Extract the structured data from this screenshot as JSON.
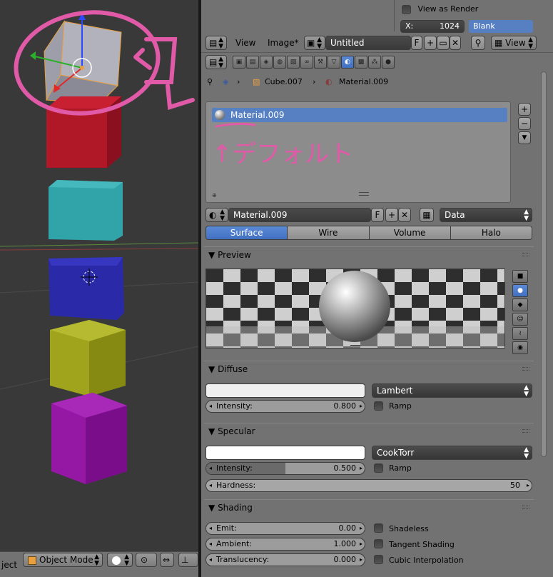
{
  "top": {
    "view_as_render": "View as Render",
    "x_label": "X:",
    "x_value": "1024",
    "blank_label": "Blank"
  },
  "image_header": {
    "view_menu": "View",
    "image_menu": "Image*",
    "image_name": "Untitled",
    "fake_user": "F",
    "view_dropdown": "View"
  },
  "breadcrumb": {
    "object": "Cube.007",
    "material": "Material.009"
  },
  "material_slots": {
    "selected": "Material.009"
  },
  "material_field": {
    "name": "Material.009",
    "fake_user": "F",
    "link": "Data"
  },
  "render_tabs": [
    "Surface",
    "Wire",
    "Volume",
    "Halo"
  ],
  "preview": {
    "title": "Preview"
  },
  "diffuse": {
    "title": "Diffuse",
    "color": "#f0f0f0",
    "shader": "Lambert",
    "intensity_label": "Intensity:",
    "intensity": "0.800",
    "intensity_value": 0.8,
    "ramp_label": "Ramp"
  },
  "specular": {
    "title": "Specular",
    "color": "#ffffff",
    "shader": "CookTorr",
    "intensity_label": "Intensity:",
    "intensity": "0.500",
    "intensity_value": 0.5,
    "ramp_label": "Ramp",
    "hardness_label": "Hardness:",
    "hardness": "50"
  },
  "shading": {
    "title": "Shading",
    "emit_label": "Emit:",
    "emit": "0.00",
    "ambient_label": "Ambient:",
    "ambient": "1.000",
    "translucency_label": "Translucency:",
    "translucency": "0.000",
    "shadeless_label": "Shadeless",
    "tangent_label": "Tangent Shading",
    "cubic_label": "Cubic Interpolation"
  },
  "viewport_header": {
    "object_menu_fragment": "ject",
    "mode": "Object Mode"
  },
  "annotations": {
    "kore_mark": "コレ",
    "default_note": "↑デフォルト"
  },
  "colors": {
    "selected_blue": "#5680c2",
    "annotation_pink": "#e05aa8",
    "cube_gray": "#a8a8b4",
    "cube_red": "#b01828",
    "cube_teal": "#30a4a8",
    "cube_blue": "#2a2aa8",
    "cube_yellow": "#a0a41c",
    "cube_purple": "#9418a4"
  }
}
